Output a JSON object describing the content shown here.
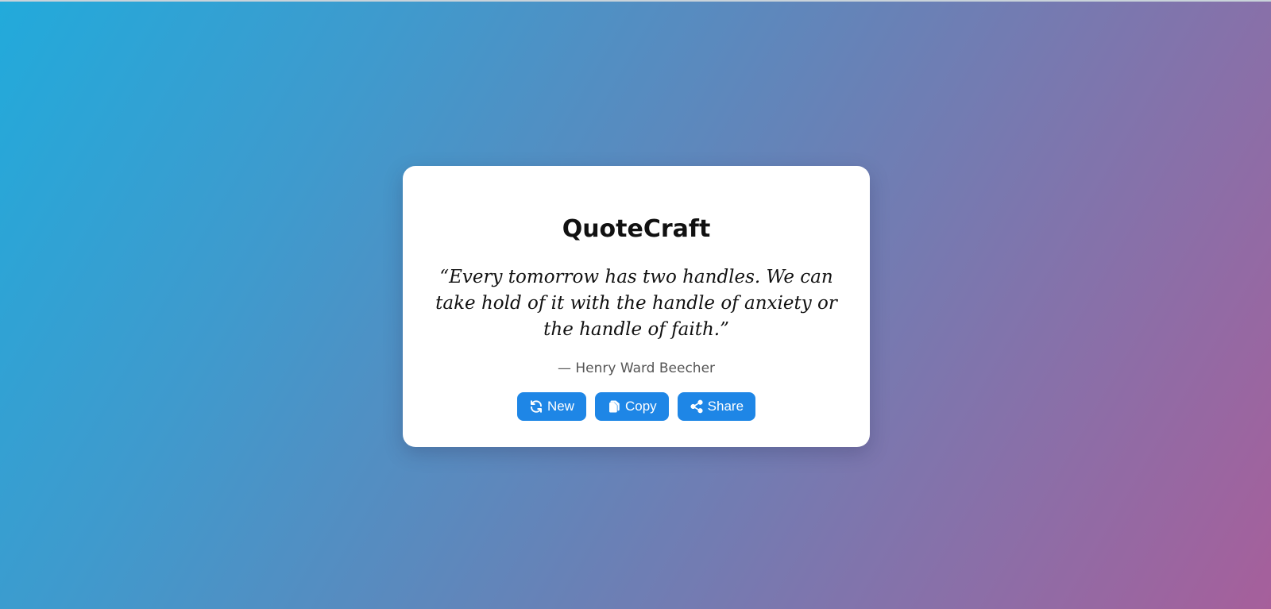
{
  "app": {
    "title": "QuoteCraft"
  },
  "quote": {
    "text": "“Every tomorrow has two handles. We can take hold of it with the handle of anxiety or the handle of faith.”",
    "author": "— Henry Ward Beecher"
  },
  "actions": {
    "new_label": "New",
    "copy_label": "Copy",
    "share_label": "Share"
  },
  "icons": {
    "new": "refresh-icon",
    "copy": "copy-icon",
    "share": "share-icon"
  },
  "colors": {
    "button": "#1e86e6",
    "gradient_start": "#22aadb",
    "gradient_end": "#a65f9b",
    "card": "#ffffff"
  }
}
